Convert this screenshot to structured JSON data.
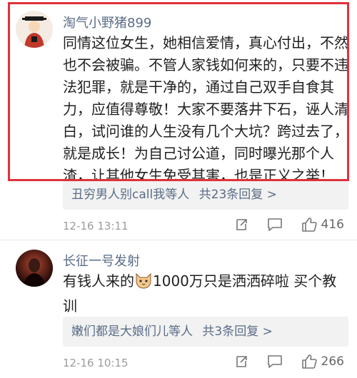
{
  "comments": [
    {
      "username": "淘气小野猪899",
      "text_lines": [
        "同情这位女生，她相信爱情，真心付出，不然",
        "也不会被骗。不管人家钱如何来的，只要不违",
        "法犯罪，就是干净的，通过自己双手自食其",
        "力，应值得尊敬！大家不要落井下石，诬人清",
        "白，试问谁的人生没有几个大坑？跨过去了，",
        "就是成长！为自己讨公道，同时曝光那个人",
        "渣，让其他女生免受其害，也是正义之举！"
      ],
      "reply_user": "丑穷男人别call我等人",
      "reply_count": "共23条回复 >",
      "timestamp": "12-16 13:11",
      "like_count": "416"
    },
    {
      "username": "长征一号发射",
      "text_line1_a": "有钱人来的",
      "text_line1_b": "1000万只是洒洒碎啦 买个教",
      "text_line2": "训",
      "reply_user": "嫩们都是大娘们儿等人",
      "reply_count": "共3条回复 >",
      "timestamp": "12-16 10:15",
      "like_count": "266"
    }
  ],
  "colors": {
    "highlight_border": "#e0313b",
    "username": "#5a6d86",
    "meta": "#9b9b9b"
  }
}
